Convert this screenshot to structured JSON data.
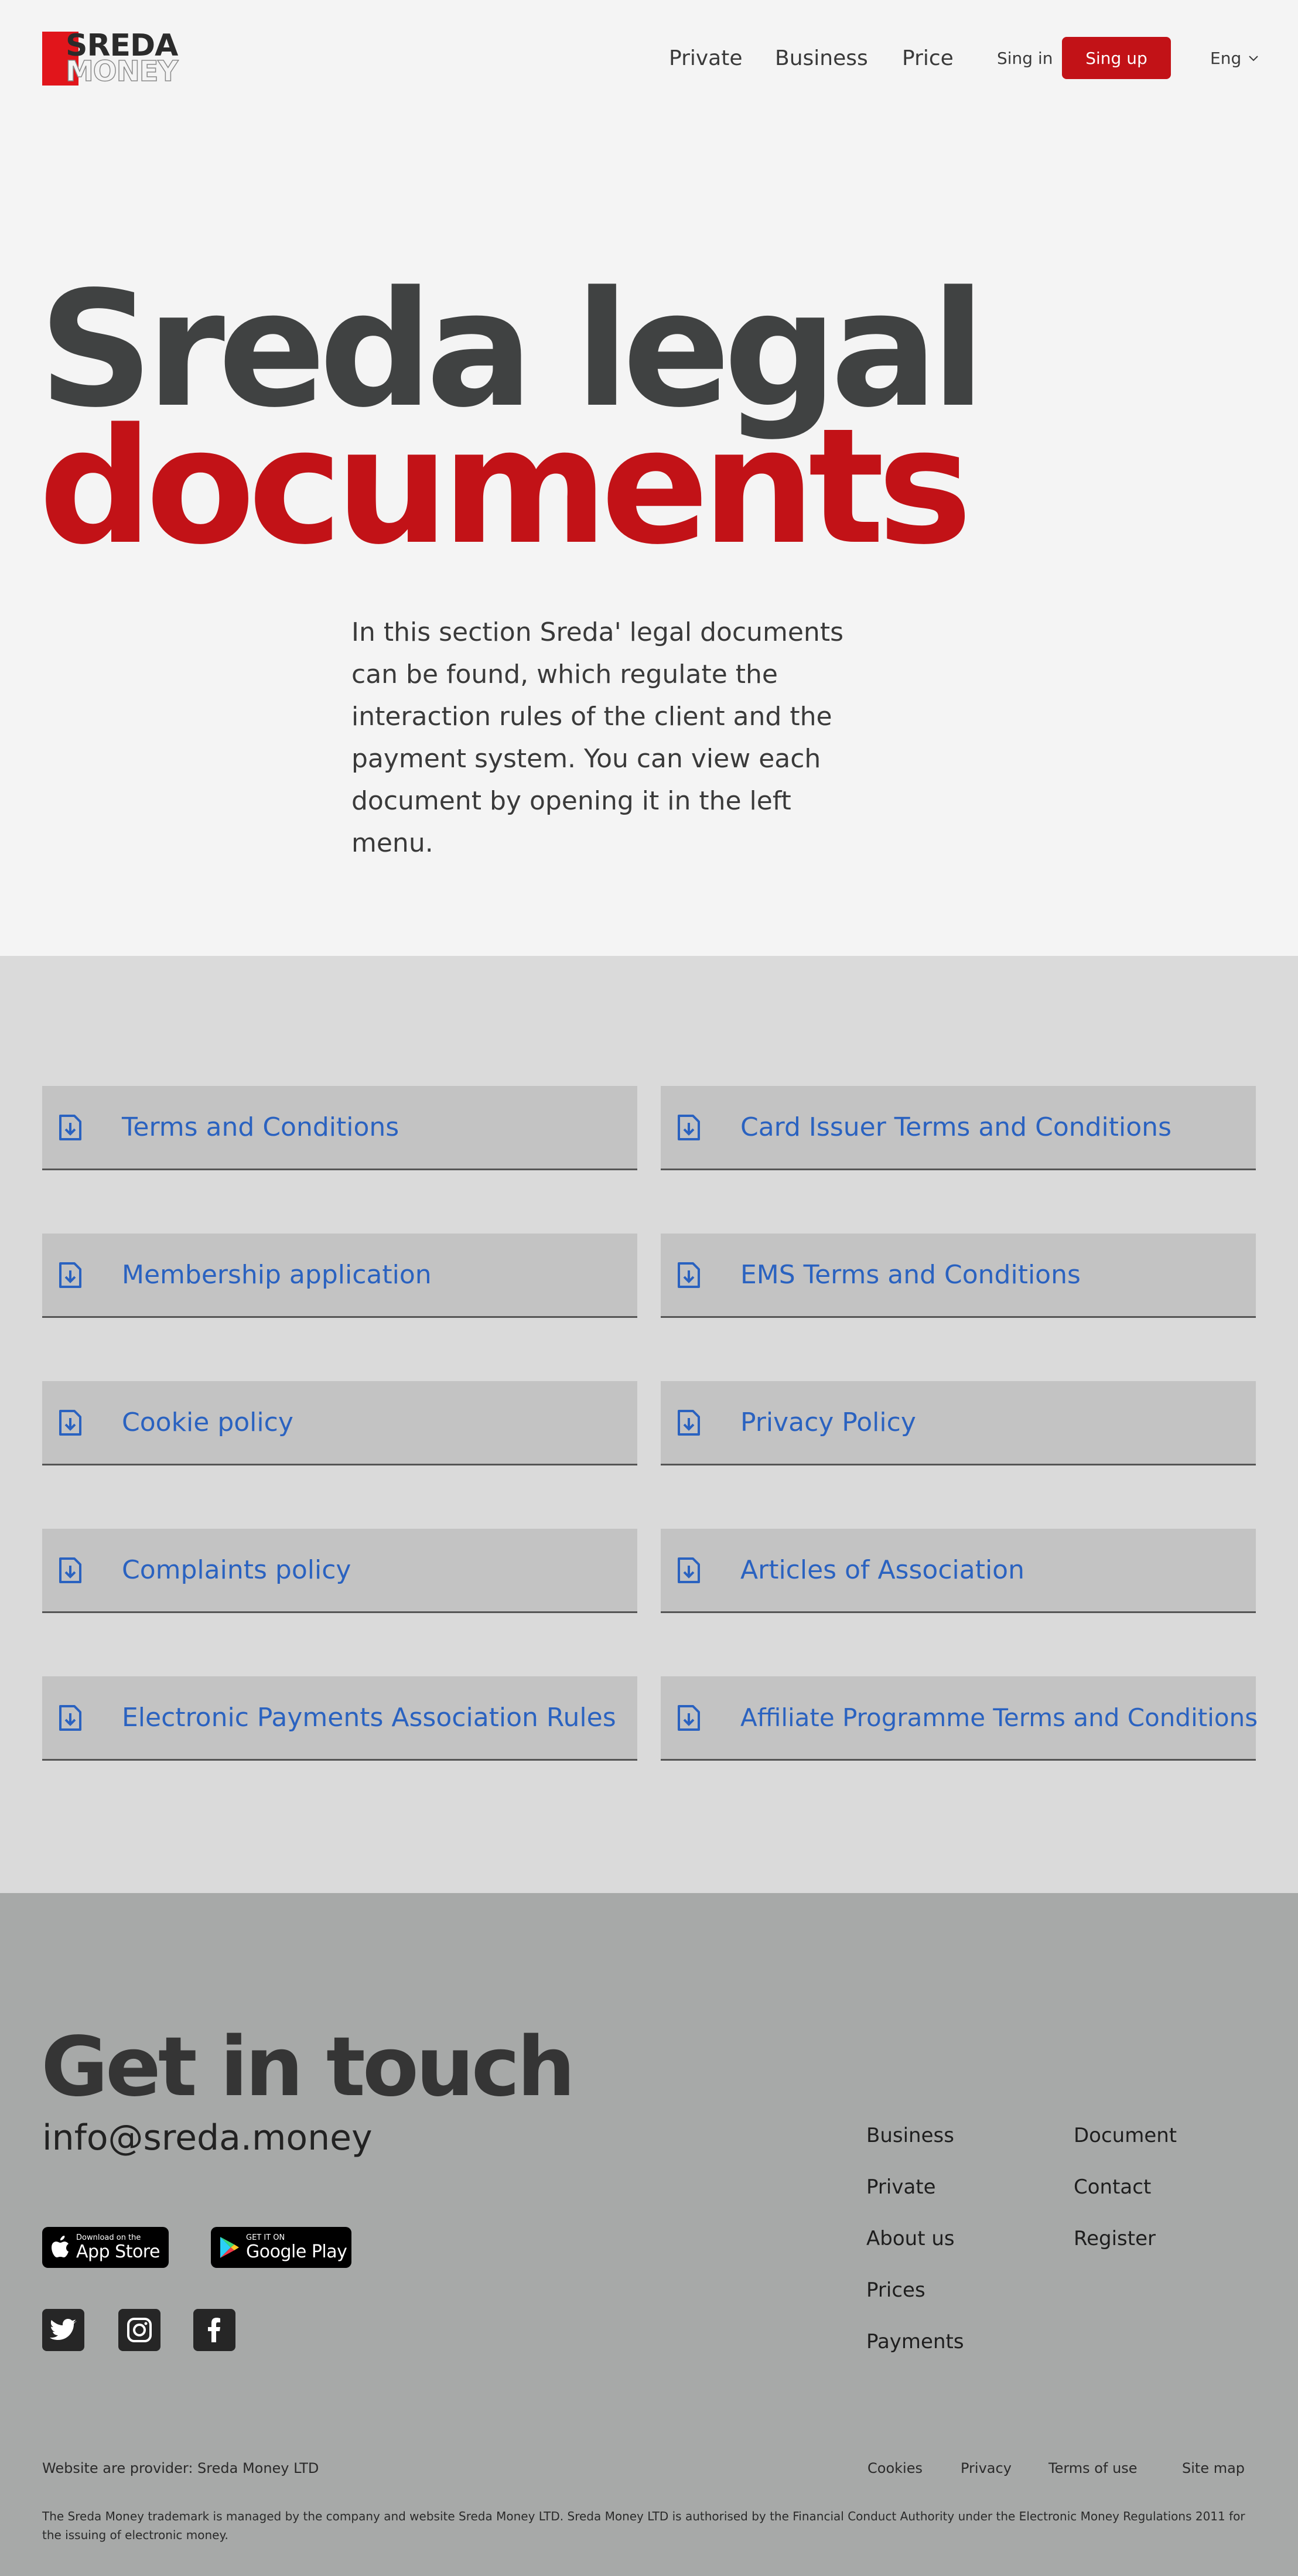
{
  "header": {
    "logo_top": "SREDA",
    "logo_bottom": "MONEY",
    "nav": [
      "Private",
      "Business",
      "Price"
    ],
    "signin": "Sing in",
    "signup": "Sing up",
    "lang": "Eng"
  },
  "hero": {
    "title_line1": "Sreda legal",
    "title_line2": "documents",
    "description": "In this section Sreda' legal documents can be found, which regulate the interaction rules of the client and the payment system. You can view each document by opening it in the left menu."
  },
  "documents": [
    "Terms and Conditions",
    "Card Issuer Terms and Conditions",
    "Membership application",
    "EMS Terms and Conditions",
    "Cookie policy",
    "Privacy Policy",
    "Complaints policy",
    "Articles of Association",
    "Electronic Payments Association Rules",
    "Affiliate Programme Terms and Conditions"
  ],
  "footer": {
    "title": "Get in touch",
    "email": "info@sreda.money",
    "app_store": {
      "small": "Download on the",
      "big": "App Store"
    },
    "google_play": {
      "small": "GET IT ON",
      "big": "Google Play"
    },
    "social": [
      "twitter-icon",
      "instagram-icon",
      "facebook-icon"
    ],
    "links_col1": [
      "Business",
      "Private",
      "About us",
      "Prices",
      "Payments"
    ],
    "links_col2": [
      "Document",
      "Contact",
      "Register"
    ],
    "provider": "Website are provider: Sreda Money LTD",
    "bottom_links": [
      "Cookies",
      "Privacy",
      "Terms of use",
      "Site map"
    ],
    "legal": "The Sreda Money trademark is managed by the company  and website Sreda Money LTD. Sreda Money LTD is authorised by the Financial Conduct Authority under the Electronic Money Regulations 2011 for the issuing of electronic money."
  },
  "colors": {
    "accent": "#c21217",
    "link": "#2a62c0",
    "hero_dark": "#404242"
  }
}
